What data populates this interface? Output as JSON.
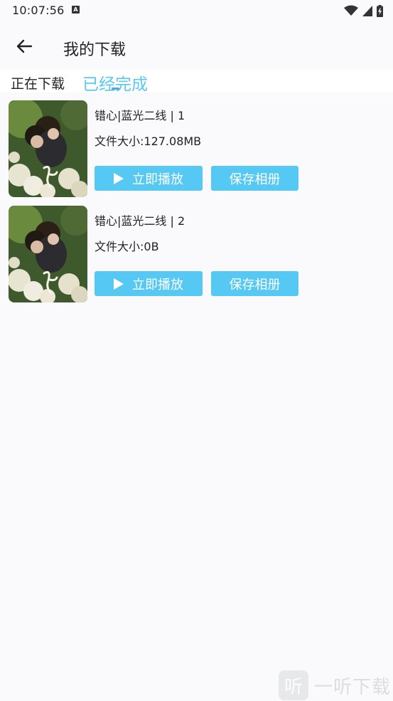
{
  "status_bar": {
    "time": "10:07:56",
    "notification_badge": "A"
  },
  "header": {
    "title": "我的下载"
  },
  "tabs": [
    {
      "label": "正在下载",
      "active": false
    },
    {
      "label": "已经完成",
      "active": true
    }
  ],
  "downloads": [
    {
      "title": "错心|蓝光二线 | 1",
      "size": "文件大小:127.08MB",
      "play_label": "立即播放",
      "save_label": "保存相册"
    },
    {
      "title": "错心|蓝光二线 | 2",
      "size": "文件大小:0B",
      "play_label": "立即播放",
      "save_label": "保存相册"
    }
  ],
  "watermark": {
    "icon_char": "听",
    "text": "一听下载"
  },
  "colors": {
    "accent": "#55c8f3",
    "tab_active": "#5ac8f2",
    "background": "#fafafc"
  }
}
